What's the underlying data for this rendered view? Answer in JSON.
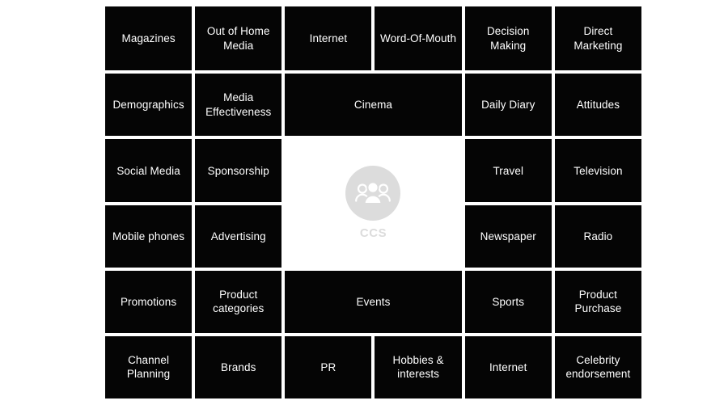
{
  "diagram": {
    "title": "CCS media and consumer touchpoints grid",
    "background_color": "#ffffff",
    "tile_color": "#050505",
    "tile_text_color": "#ffffff",
    "logo_color": "#dcdcdc"
  },
  "logo": {
    "icon": "group-of-people-icon",
    "caption": "CCS"
  },
  "grid": {
    "columns": 6,
    "rows": 6,
    "tiles": [
      {
        "label": "Magazines",
        "row": 1,
        "col": 1,
        "span": 1
      },
      {
        "label": "Out of Home Media",
        "row": 1,
        "col": 2,
        "span": 1
      },
      {
        "label": "Internet",
        "row": 1,
        "col": 3,
        "span": 1
      },
      {
        "label": "Word-Of-Mouth",
        "row": 1,
        "col": 4,
        "span": 1
      },
      {
        "label": "Decision Making",
        "row": 1,
        "col": 5,
        "span": 1
      },
      {
        "label": "Direct Marketing",
        "row": 1,
        "col": 6,
        "span": 1
      },
      {
        "label": "Demographics",
        "row": 2,
        "col": 1,
        "span": 1
      },
      {
        "label": "Media Effectiveness",
        "row": 2,
        "col": 2,
        "span": 1
      },
      {
        "label": "Cinema",
        "row": 2,
        "col": 3,
        "span": 2
      },
      {
        "label": "Daily Diary",
        "row": 2,
        "col": 5,
        "span": 1
      },
      {
        "label": "Attitudes",
        "row": 2,
        "col": 6,
        "span": 1
      },
      {
        "label": "Social Media",
        "row": 3,
        "col": 1,
        "span": 1
      },
      {
        "label": "Sponsorship",
        "row": 3,
        "col": 2,
        "span": 1
      },
      {
        "label": "Travel",
        "row": 3,
        "col": 5,
        "span": 1
      },
      {
        "label": "Television",
        "row": 3,
        "col": 6,
        "span": 1
      },
      {
        "label": "Mobile phones",
        "row": 4,
        "col": 1,
        "span": 1
      },
      {
        "label": "Advertising",
        "row": 4,
        "col": 2,
        "span": 1
      },
      {
        "label": "Newspaper",
        "row": 4,
        "col": 5,
        "span": 1
      },
      {
        "label": "Radio",
        "row": 4,
        "col": 6,
        "span": 1
      },
      {
        "label": "Promotions",
        "row": 5,
        "col": 1,
        "span": 1
      },
      {
        "label": "Product categories",
        "row": 5,
        "col": 2,
        "span": 1
      },
      {
        "label": "Events",
        "row": 5,
        "col": 3,
        "span": 2
      },
      {
        "label": "Sports",
        "row": 5,
        "col": 5,
        "span": 1
      },
      {
        "label": "Product Purchase",
        "row": 5,
        "col": 6,
        "span": 1
      },
      {
        "label": "Channel Planning",
        "row": 6,
        "col": 1,
        "span": 1
      },
      {
        "label": "Brands",
        "row": 6,
        "col": 2,
        "span": 1
      },
      {
        "label": "PR",
        "row": 6,
        "col": 3,
        "span": 1
      },
      {
        "label": "Hobbies & interests",
        "row": 6,
        "col": 4,
        "span": 1
      },
      {
        "label": "Internet",
        "row": 6,
        "col": 5,
        "span": 1
      },
      {
        "label": "Celebrity endorsement",
        "row": 6,
        "col": 6,
        "span": 1
      }
    ]
  }
}
